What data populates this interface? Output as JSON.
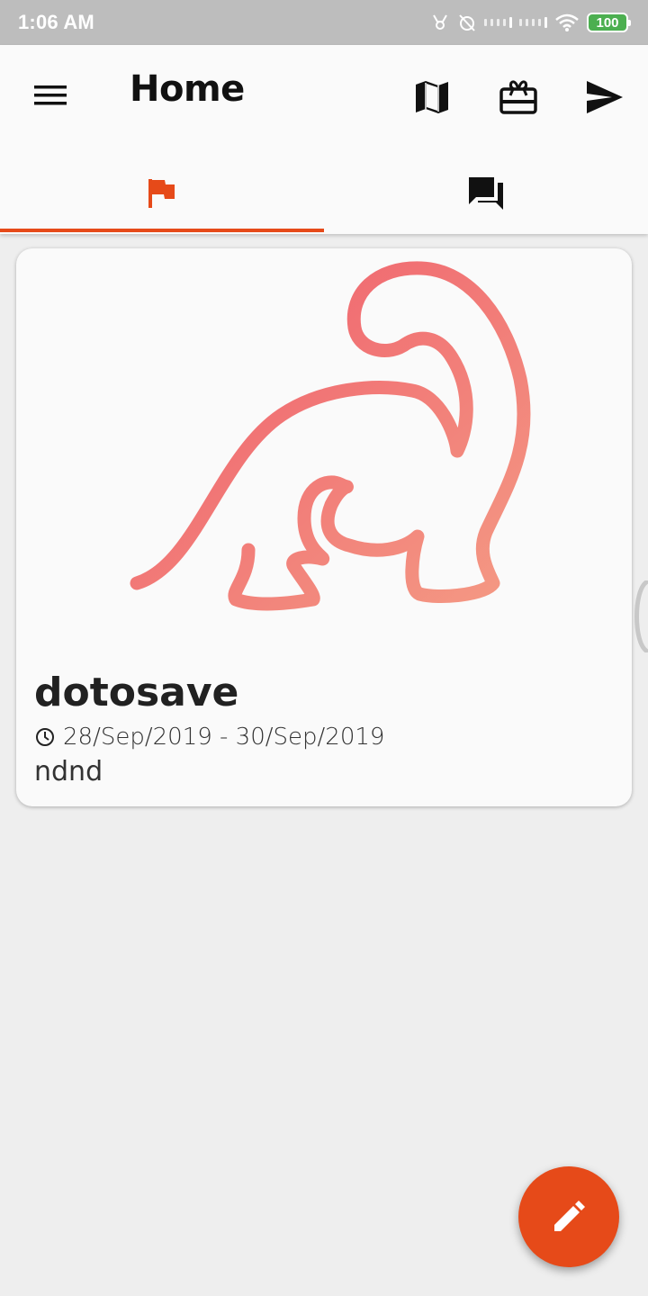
{
  "status_bar": {
    "time": "1:06 AM",
    "battery": "100"
  },
  "app_bar": {
    "title": "Home",
    "menu_icon": "menu-icon",
    "actions": [
      {
        "icon": "map-icon"
      },
      {
        "icon": "gift-card-icon"
      },
      {
        "icon": "send-icon"
      }
    ]
  },
  "tabs": [
    {
      "icon": "flag-icon",
      "selected": true
    },
    {
      "icon": "forum-icon",
      "selected": false
    }
  ],
  "card": {
    "title": "dotosave",
    "dates": "28/Sep/2019 - 30/Sep/2019",
    "description": "ndnd",
    "image_icon": "dinosaur-illustration"
  },
  "fab": {
    "icon": "pencil-icon"
  },
  "colors": {
    "accent": "#e64a19",
    "status_bar": "#bdbdbd",
    "background": "#eeeeee",
    "dino_start": "#ef5b6b",
    "dino_end": "#f49a84"
  }
}
